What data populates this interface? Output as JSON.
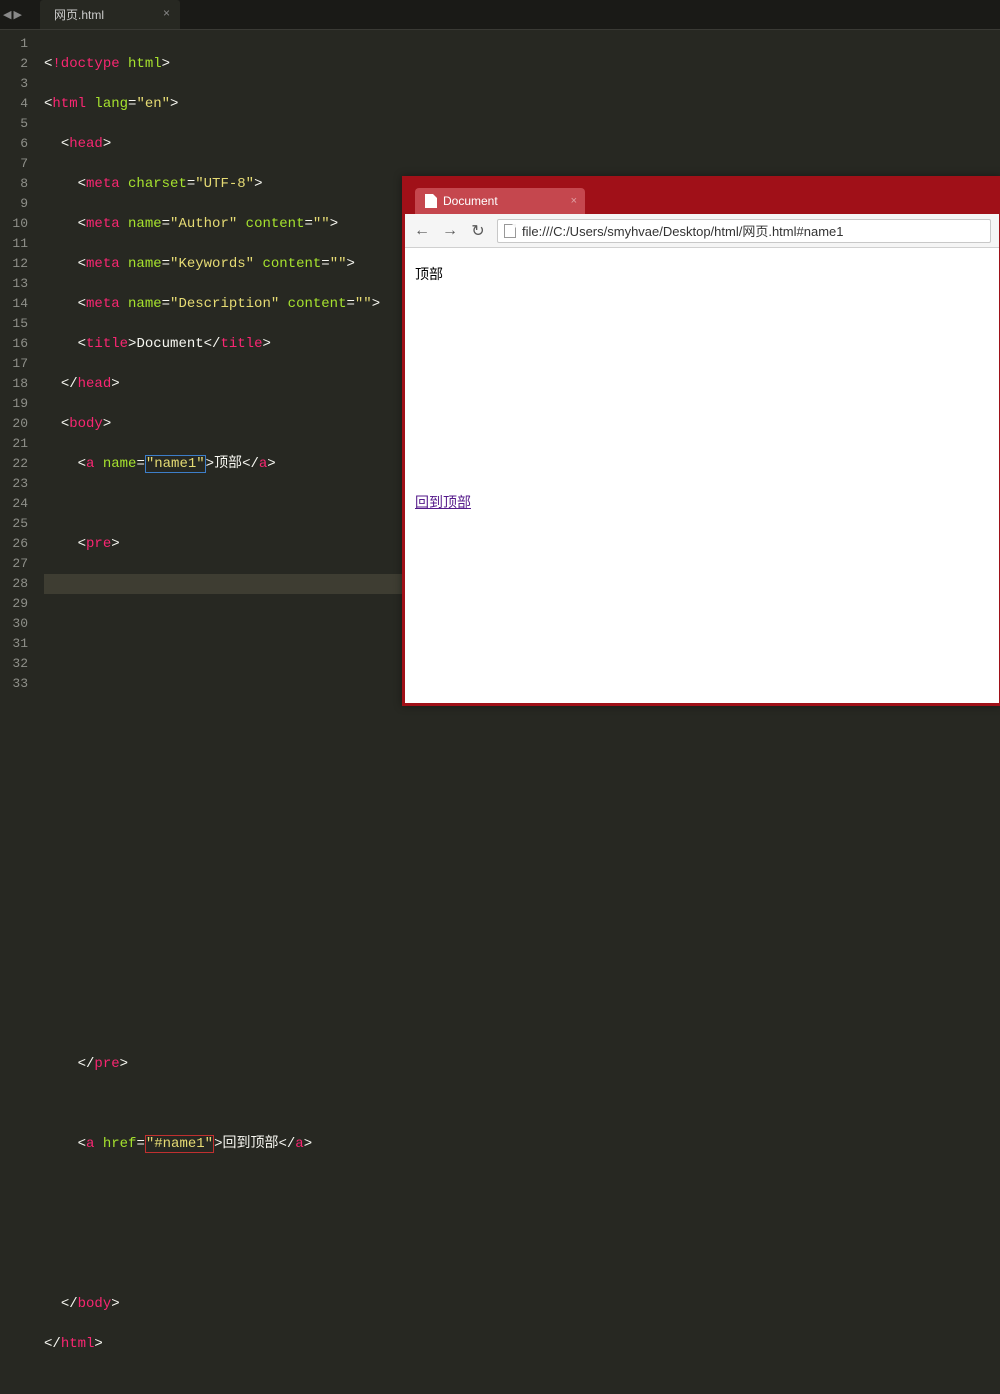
{
  "nav": {
    "back": "◀",
    "forward": "▶"
  },
  "tab": {
    "title": "网页.html",
    "close": "×"
  },
  "gutter": {
    "start": 1,
    "end": 33
  },
  "code": {
    "l1": {
      "doctype": "!doctype",
      "html": "html"
    },
    "l2": {
      "tag": "html",
      "attr": "lang",
      "val": "\"en\""
    },
    "l3": {
      "tag": "head"
    },
    "l4": {
      "tag": "meta",
      "attr": "charset",
      "val": "\"UTF-8\""
    },
    "l5": {
      "tag": "meta",
      "a1": "name",
      "v1": "\"Author\"",
      "a2": "content",
      "v2": "\"\""
    },
    "l6": {
      "tag": "meta",
      "a1": "name",
      "v1": "\"Keywords\"",
      "a2": "content",
      "v2": "\"\""
    },
    "l7": {
      "tag": "meta",
      "a1": "name",
      "v1": "\"Description\"",
      "a2": "content",
      "v2": "\"\""
    },
    "l8": {
      "tag": "title",
      "text": "Document"
    },
    "l9": {
      "tag": "head"
    },
    "l10": {
      "tag": "body"
    },
    "l11": {
      "tag": "a",
      "attr": "name",
      "val": "\"name1\"",
      "text": "顶部"
    },
    "l13": {
      "tag": "pre"
    },
    "l26": {
      "tag": "pre"
    },
    "l28": {
      "tag": "a",
      "attr": "href",
      "val": "\"#name1\"",
      "text": "回到顶部"
    },
    "l32": {
      "tag": "body"
    },
    "l33": {
      "tag": "html"
    }
  },
  "browser": {
    "tab_title": "Document",
    "tab_close": "×",
    "back": "←",
    "forward": "→",
    "reload": "↻",
    "url": "file:///C:/Users/smyhvae/Desktop/html/网页.html#name1",
    "content_top": "顶部",
    "content_link": "回到顶部"
  }
}
